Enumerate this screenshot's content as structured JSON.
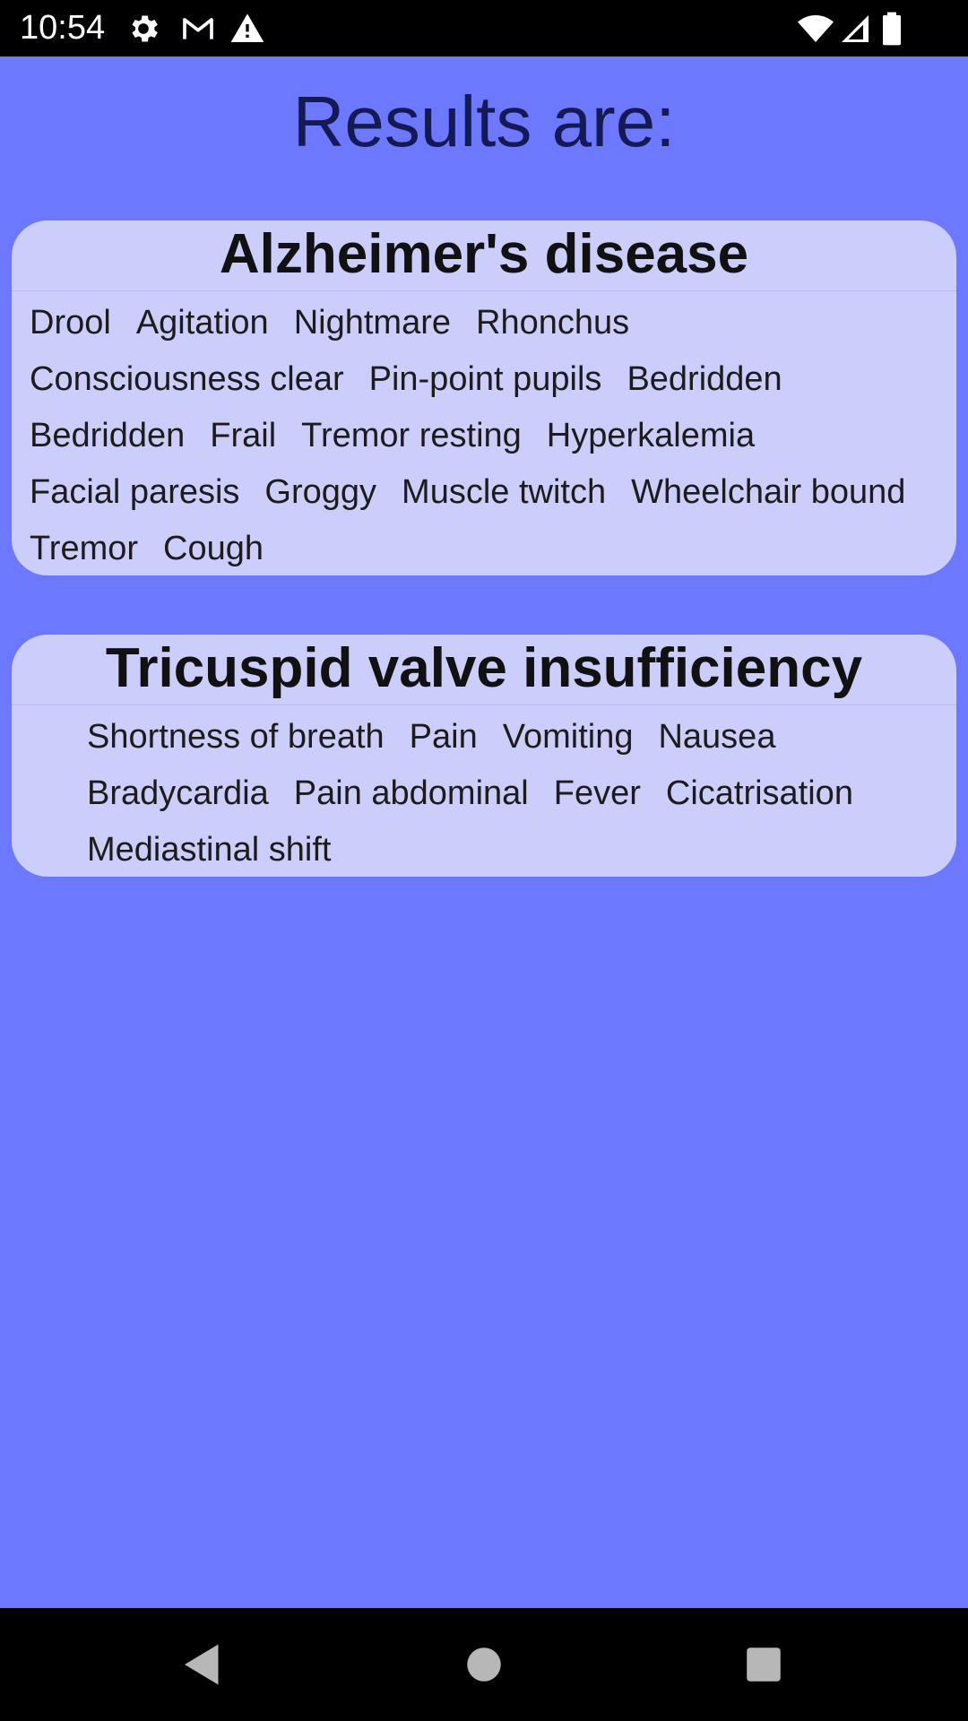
{
  "status_bar": {
    "time": "10:54",
    "icons": [
      "gear-icon",
      "gmail-icon",
      "warning-icon",
      "wifi-icon",
      "signal-icon",
      "battery-icon"
    ]
  },
  "page": {
    "title": "Results are:"
  },
  "results": [
    {
      "disease": "Alzheimer's disease",
      "symptoms": [
        "Drool",
        "Agitation",
        "Nightmare",
        "Rhonchus",
        "Consciousness clear",
        "Pin-point pupils",
        "Bedridden",
        "Bedridden",
        "Frail",
        "Tremor resting",
        "Hyperkalemia",
        "Facial paresis",
        "Groggy",
        "Muscle twitch",
        "Wheelchair bound",
        "Tremor",
        "Cough"
      ]
    },
    {
      "disease": "Tricuspid valve insufficiency",
      "symptoms": [
        "Shortness of breath",
        "Pain",
        "Vomiting",
        "Nausea",
        "Bradycardia",
        "Pain abdominal",
        "Fever",
        "Cicatrisation",
        "Mediastinal shift"
      ]
    }
  ],
  "nav_bar": {
    "icons": [
      "back-icon",
      "home-icon",
      "recents-icon"
    ]
  },
  "colors": {
    "background": "#6b78ff",
    "card": "#cbcdfb",
    "title": "#161a52"
  }
}
